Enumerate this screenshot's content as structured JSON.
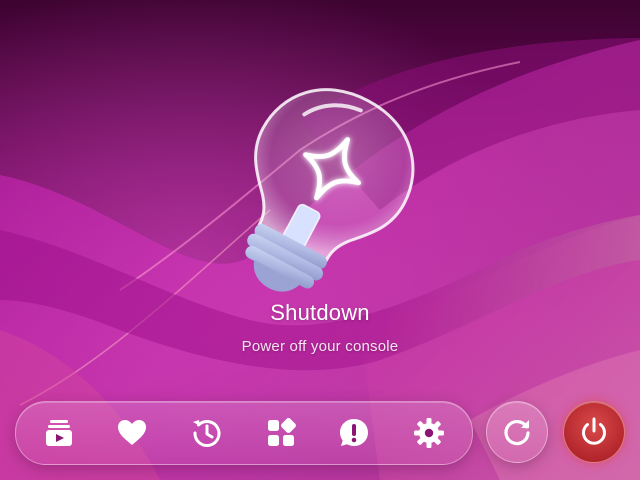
{
  "screen": {
    "title": "Shutdown",
    "subtitle": "Power off your console"
  },
  "hero": {
    "icon": "lightbulb-sparkle-icon"
  },
  "dock": {
    "items": [
      {
        "name": "media-library",
        "icon": "media-library-icon"
      },
      {
        "name": "favorites",
        "icon": "heart-icon"
      },
      {
        "name": "history",
        "icon": "history-icon"
      },
      {
        "name": "apps",
        "icon": "apps-grid-icon"
      },
      {
        "name": "alerts",
        "icon": "alert-bubble-icon"
      },
      {
        "name": "settings",
        "icon": "gear-icon"
      }
    ]
  },
  "actions": {
    "restart": {
      "icon": "restart-icon"
    },
    "power": {
      "icon": "power-icon",
      "color": "#c0303a"
    }
  },
  "colors": {
    "background": "#6a0a55",
    "accent_magenta": "#b0139e",
    "power_red": "#c0303a"
  }
}
